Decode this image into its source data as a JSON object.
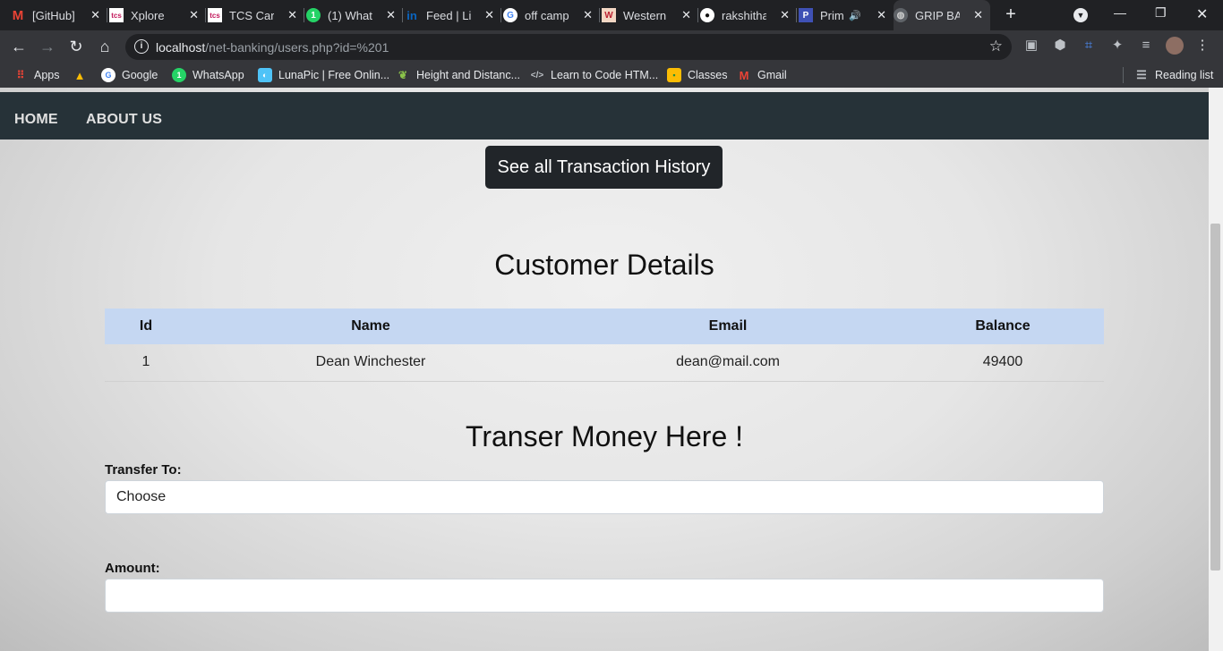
{
  "tabs": [
    {
      "title": "[GitHub]",
      "icon": "gmail-icon"
    },
    {
      "title": "Xplore",
      "icon": "tcs-icon"
    },
    {
      "title": "TCS Care",
      "icon": "tcs-icon"
    },
    {
      "title": "(1) What",
      "icon": "whatsapp-icon"
    },
    {
      "title": "Feed | Li",
      "icon": "linkedin-icon"
    },
    {
      "title": "off camp",
      "icon": "google-icon"
    },
    {
      "title": "Western",
      "icon": "western-icon"
    },
    {
      "title": "rakshitha",
      "icon": "github-icon"
    },
    {
      "title": "Prim",
      "icon": "prime-icon"
    },
    {
      "title": "GRIP BA",
      "icon": "globe-icon"
    }
  ],
  "toolbar": {
    "url_host": "localhost",
    "url_path": "/net-banking/users.php?id=%201"
  },
  "bookmarks": [
    {
      "label": "Apps",
      "icon": "apps-icon"
    },
    {
      "label": "",
      "icon": "drive-icon"
    },
    {
      "label": "Google",
      "icon": "google-icon"
    },
    {
      "label": "WhatsApp",
      "icon": "whatsapp-icon"
    },
    {
      "label": "LunaPic | Free Onlin...",
      "icon": "lunapic-icon"
    },
    {
      "label": "Height and Distanc...",
      "icon": "leaf-icon"
    },
    {
      "label": "Learn to Code HTM...",
      "icon": "code-icon"
    },
    {
      "label": "Classes",
      "icon": "classroom-icon"
    },
    {
      "label": "Gmail",
      "icon": "gmail-icon"
    }
  ],
  "reading_list": "Reading list",
  "navbar": {
    "home": "HOME",
    "about": "ABOUT US"
  },
  "history_button": "See all Transaction History",
  "customer_heading": "Customer Details",
  "table": {
    "headers": [
      "Id",
      "Name",
      "Email",
      "Balance"
    ],
    "row": [
      "1",
      "Dean Winchester",
      "dean@mail.com",
      "49400"
    ]
  },
  "transfer_heading": "Transer Money Here !",
  "form": {
    "to_label": "Transfer To:",
    "to_value": "Choose",
    "amount_label": "Amount:",
    "amount_value": ""
  }
}
